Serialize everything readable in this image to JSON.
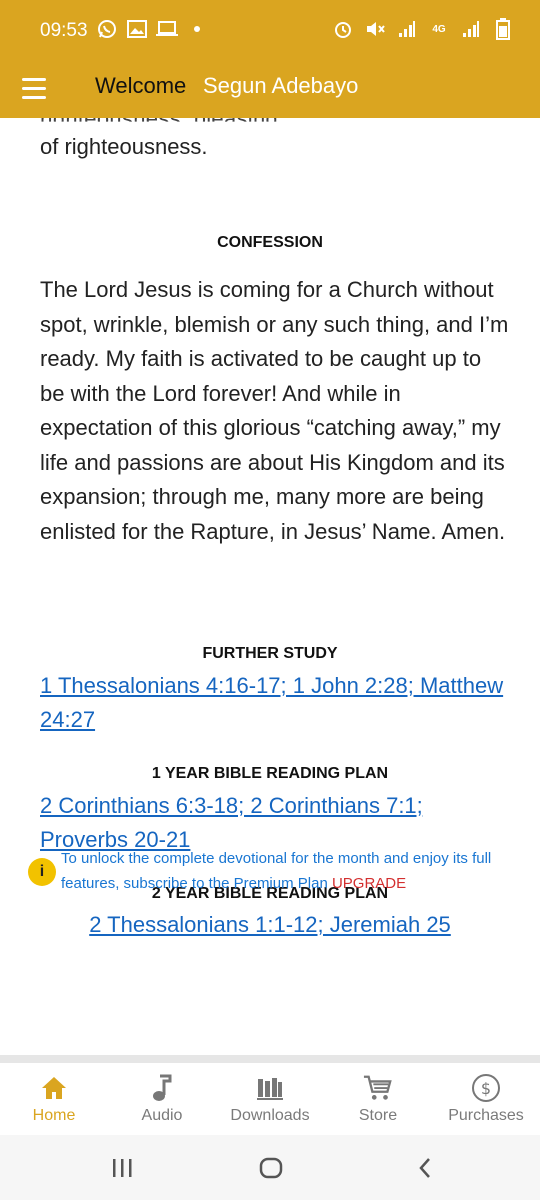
{
  "status_bar": {
    "time": "09:53",
    "left_icons": [
      "whatsapp-icon",
      "gallery-icon",
      "laptop-icon",
      "dot-icon"
    ],
    "right_icons": [
      "alarm-icon",
      "mute-icon",
      "signal-icon",
      "lte-icon",
      "signal-icon",
      "battery-icon"
    ],
    "network_label": "4G"
  },
  "app_bar": {
    "welcome_label": "Welcome",
    "user_name": "Segun Adebayo"
  },
  "article": {
    "previous_para_cut": "righteousness, pleasing",
    "previous_para_end": "of righteousness.",
    "confession_heading": "CONFESSION",
    "confession_text": "The Lord Jesus is coming for a Church without spot, wrinkle, blemish or any such thing, and I’m ready. My faith is activated to be caught up to be with the Lord forever! And while in expectation of this glorious “catching away,” my life and passions are about His Kingdom and its expansion; through me, many more are being enlisted for the Rapture, in Jesus’ Name. Amen.",
    "further_study_heading": "FURTHER STUDY",
    "further_study_refs": "1 Thessalonians 4:16-17; 1 John 2:28; Matthew 24:27",
    "one_year_heading": "1 YEAR BIBLE READING PLAN",
    "one_year_refs": "2 Corinthians 6:3-18; 2 Corinthians 7:1; Proverbs 20-21",
    "two_year_heading": "2 YEAR BIBLE READING PLAN",
    "two_year_refs": "2 Thessalonians 1:1-12; Jeremiah 25"
  },
  "notice": {
    "icon_glyph": "i",
    "text": "To unlock the complete devotional for the month and enjoy its full features, subscribe to the Premium Plan ",
    "upgrade_label": "UPGRADE"
  },
  "bottom_nav": {
    "items": [
      {
        "label": "Home",
        "icon": "home-icon",
        "active": true
      },
      {
        "label": "Audio",
        "icon": "music-note-icon",
        "active": false
      },
      {
        "label": "Downloads",
        "icon": "library-icon",
        "active": false
      },
      {
        "label": "Store",
        "icon": "cart-icon",
        "active": false
      },
      {
        "label": "Purchases",
        "icon": "dollar-circle-icon",
        "active": false
      }
    ]
  },
  "colors": {
    "accent": "#DAA520",
    "link": "#1565C0",
    "upgrade": "#D32F2F"
  }
}
